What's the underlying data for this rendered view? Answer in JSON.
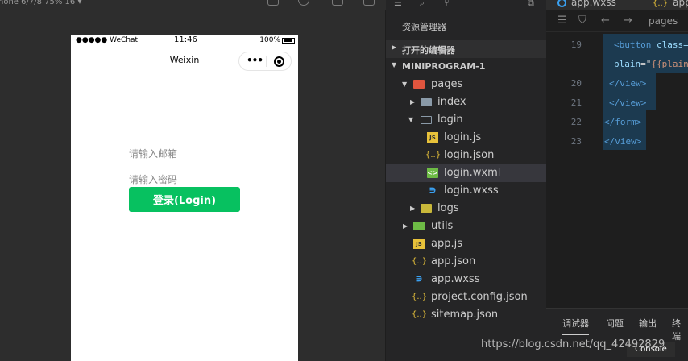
{
  "simulator": {
    "device_label": "hone 6/7/8 75% 16 ▾",
    "status": {
      "carrier": "●●●●● WeChat",
      "time": "11:46",
      "battery": "100%"
    },
    "nav_title": "Weixin",
    "capsule_menu": "•••",
    "email_placeholder": "请输入邮箱",
    "password_placeholder": "请输入密码",
    "login_label": "登录(Login)",
    "accent": "#07c160"
  },
  "explorer": {
    "title": "资源管理器",
    "open_editors": "打开的编辑器",
    "project": "MINIPROGRAM-1",
    "items": [
      {
        "name": "pages"
      },
      {
        "name": "index"
      },
      {
        "name": "login"
      },
      {
        "name": "login.js"
      },
      {
        "name": "login.json"
      },
      {
        "name": "login.wxml"
      },
      {
        "name": "login.wxss"
      },
      {
        "name": "logs"
      },
      {
        "name": "utils"
      },
      {
        "name": "app.js"
      },
      {
        "name": "app.json"
      },
      {
        "name": "app.wxss"
      },
      {
        "name": "project.config.json"
      },
      {
        "name": "sitemap.json"
      }
    ],
    "icons": {
      "js": "JS",
      "json": "{..}",
      "css": "∍",
      "wxml": "<>"
    }
  },
  "editor": {
    "tabs": [
      "app.wxss",
      "app"
    ],
    "breadcrumb": "pages",
    "lines": {
      "l19": "19",
      "l20": "20",
      "l21": "21",
      "l22": "22",
      "l23": "23"
    },
    "code": {
      "c19_tag": "<button",
      "c19_attr": " class=",
      "c19b_attr": "plain",
      "c19b_eq": "=\"",
      "c19b_str": "{{plain",
      "c20": "</view>",
      "c21": "</view>",
      "c22": "</form>",
      "c23": "</view>"
    },
    "panel": {
      "debugger": "调试器",
      "problems": "问题",
      "output": "输出",
      "terminal": "终端"
    },
    "console": "Console"
  },
  "watermark": "https://blog.csdn.net/qq_42492829"
}
